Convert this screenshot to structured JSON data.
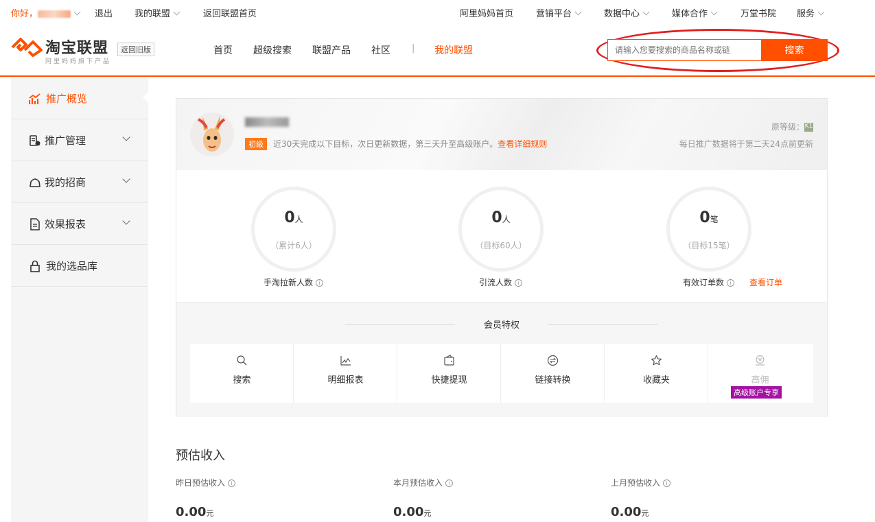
{
  "topbar": {
    "greeting": "你好，",
    "logout": "退出",
    "my_union": "我的联盟",
    "back_home": "返回联盟首页",
    "right_items": [
      "阿里妈妈首页",
      "营销平台",
      "数据中心",
      "媒体合作",
      "万堂书院",
      "服务"
    ]
  },
  "header": {
    "logo_title": "淘宝联盟",
    "logo_sub": "阿里妈妈旗下产品",
    "old_version": "返回旧版",
    "nav": [
      "首页",
      "超级搜索",
      "联盟产品",
      "社区"
    ],
    "nav_sep": "|",
    "nav_active": "我的联盟",
    "search_placeholder": "请输入您要搜索的商品名称或链",
    "search_button": "搜索"
  },
  "sidebar": {
    "items": [
      {
        "label": "推广概览",
        "icon": "chart-icon"
      },
      {
        "label": "推广管理",
        "icon": "manage-icon"
      },
      {
        "label": "我的招商",
        "icon": "bag-icon"
      },
      {
        "label": "效果报表",
        "icon": "report-icon"
      },
      {
        "label": "我的选品库",
        "icon": "lock-icon"
      }
    ]
  },
  "profile": {
    "level_badge": "初级",
    "level_text": "近30天完成以下目标，次日更新数据，第三天升至高级账户。",
    "level_link": "查看详细规则",
    "orig_level": "原等级：",
    "orig_level_icon": "K1",
    "daily_note": "每日推广数据将于第二天24点前更新"
  },
  "stats": [
    {
      "value": "0",
      "unit": "人",
      "sub": "（累计6人）",
      "label": "手淘拉新人数"
    },
    {
      "value": "0",
      "unit": "人",
      "sub": "（目标60人）",
      "label": "引流人数"
    },
    {
      "value": "0",
      "unit": "笔",
      "sub": "（目标15笔）",
      "label": "有效订单数"
    }
  ],
  "view_orders": "查看订单",
  "benefits": {
    "title": "会员特权",
    "items": [
      {
        "label": "搜索",
        "icon": "search-icon"
      },
      {
        "label": "明细报表",
        "icon": "line-chart-icon"
      },
      {
        "label": "快捷提现",
        "icon": "wallet-icon"
      },
      {
        "label": "链接转换",
        "icon": "convert-icon"
      },
      {
        "label": "收藏夹",
        "icon": "star-icon"
      },
      {
        "label": "高佣",
        "icon": "coin-icon"
      }
    ],
    "vip_tag": "高级账户专享"
  },
  "income": {
    "title": "预估收入",
    "items": [
      {
        "label": "昨日预估收入",
        "value": "0.00",
        "unit": "元"
      },
      {
        "label": "本月预估收入",
        "value": "0.00",
        "unit": "元"
      },
      {
        "label": "上月预估收入",
        "value": "0.00",
        "unit": "元"
      }
    ]
  },
  "colors": {
    "accent": "#ff5000",
    "vip": "#a312a3",
    "highlight_ring": "#e02020"
  }
}
